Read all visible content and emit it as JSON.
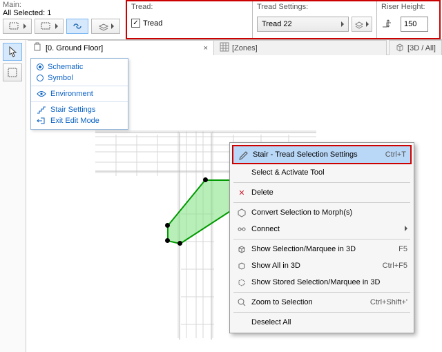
{
  "top": {
    "main_label": "Main:",
    "all_selected_label": "All Selected: 1"
  },
  "panel": {
    "tread_label": "Tread:",
    "tread_checkbox": "Tread",
    "settings_label": "Tread Settings:",
    "settings_value": "Tread 22",
    "riser_label": "Riser Height:",
    "riser_value": "150"
  },
  "tabs": {
    "plan": "[0. Ground Floor]",
    "zones": "[Zones]",
    "view3d": "[3D / All]"
  },
  "side_menu": {
    "schematic": "Schematic",
    "symbol": "Symbol",
    "environment": "Environment",
    "stair_settings": "Stair Settings",
    "exit_edit": "Exit Edit Mode"
  },
  "ctx": {
    "tread_settings": "Stair - Tread Selection Settings",
    "tread_settings_short": "Ctrl+T",
    "select_activate": "Select & Activate Tool",
    "delete": "Delete",
    "morph": "Convert Selection to Morph(s)",
    "connect": "Connect",
    "show_sel_3d": "Show Selection/Marquee in 3D",
    "show_sel_3d_short": "F5",
    "show_all_3d": "Show All in 3D",
    "show_all_3d_short": "Ctrl+F5",
    "show_stored_3d": "Show Stored Selection/Marquee in 3D",
    "zoom_sel": "Zoom to Selection",
    "zoom_sel_short": "Ctrl+Shift+'",
    "deselect": "Deselect All"
  }
}
